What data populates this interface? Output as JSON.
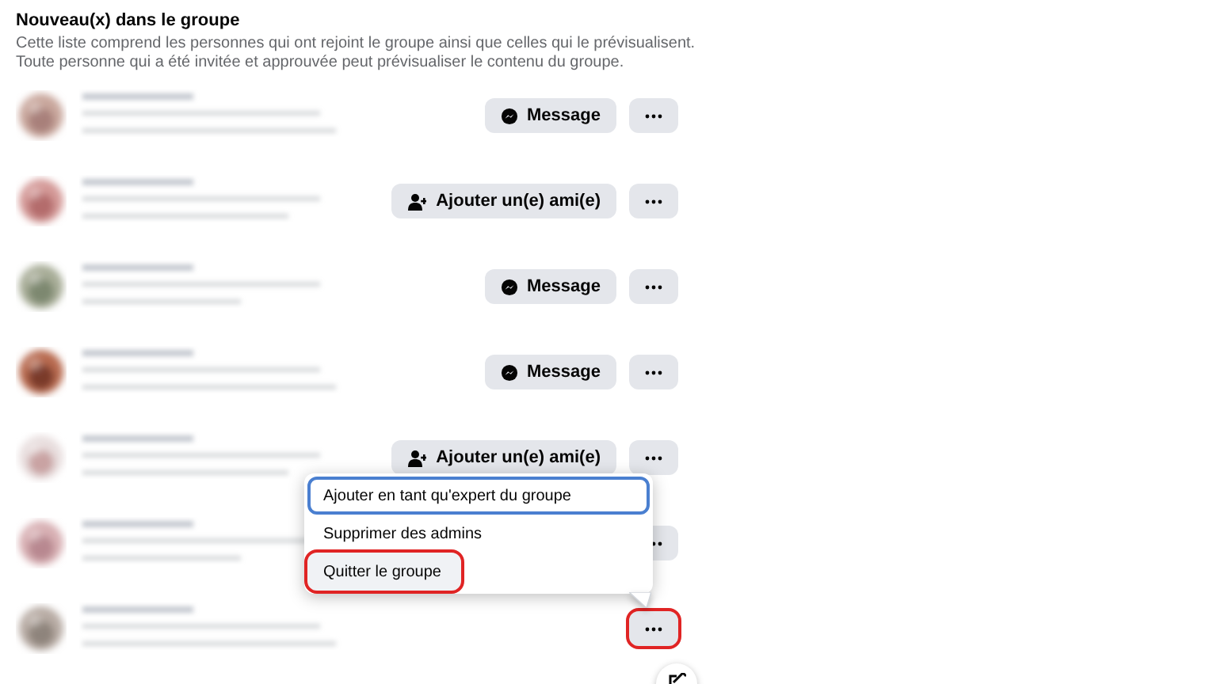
{
  "section": {
    "title": "Nouveau(x) dans le groupe",
    "description": [
      "Cette liste comprend les personnes qui ont rejoint le groupe ainsi que celles qui le prévisualisent.",
      "Toute personne qui a été invitée et approuvée peut prévisualiser le contenu du groupe."
    ]
  },
  "members": [
    {
      "action": {
        "kind": "message",
        "label": "Message"
      },
      "more_highlighted": false
    },
    {
      "action": {
        "kind": "add_friend",
        "label": "Ajouter un(e) ami(e)"
      },
      "more_highlighted": false
    },
    {
      "action": {
        "kind": "message",
        "label": "Message"
      },
      "more_highlighted": false
    },
    {
      "action": {
        "kind": "message",
        "label": "Message"
      },
      "more_highlighted": false
    },
    {
      "action": {
        "kind": "add_friend",
        "label": "Ajouter un(e) ami(e)"
      },
      "more_highlighted": false
    },
    {
      "action": {
        "kind": "hidden"
      },
      "more_highlighted": false
    },
    {
      "action": {
        "kind": "none"
      },
      "more_highlighted": true
    }
  ],
  "menu": {
    "items": [
      {
        "label": "Ajouter en tant qu'expert du groupe",
        "focused": true,
        "hovered": false,
        "highlighted": false
      },
      {
        "label": "Supprimer des admins",
        "focused": false,
        "hovered": false,
        "highlighted": false
      },
      {
        "label": "Quitter le groupe",
        "focused": false,
        "hovered": true,
        "highlighted": true
      }
    ]
  }
}
